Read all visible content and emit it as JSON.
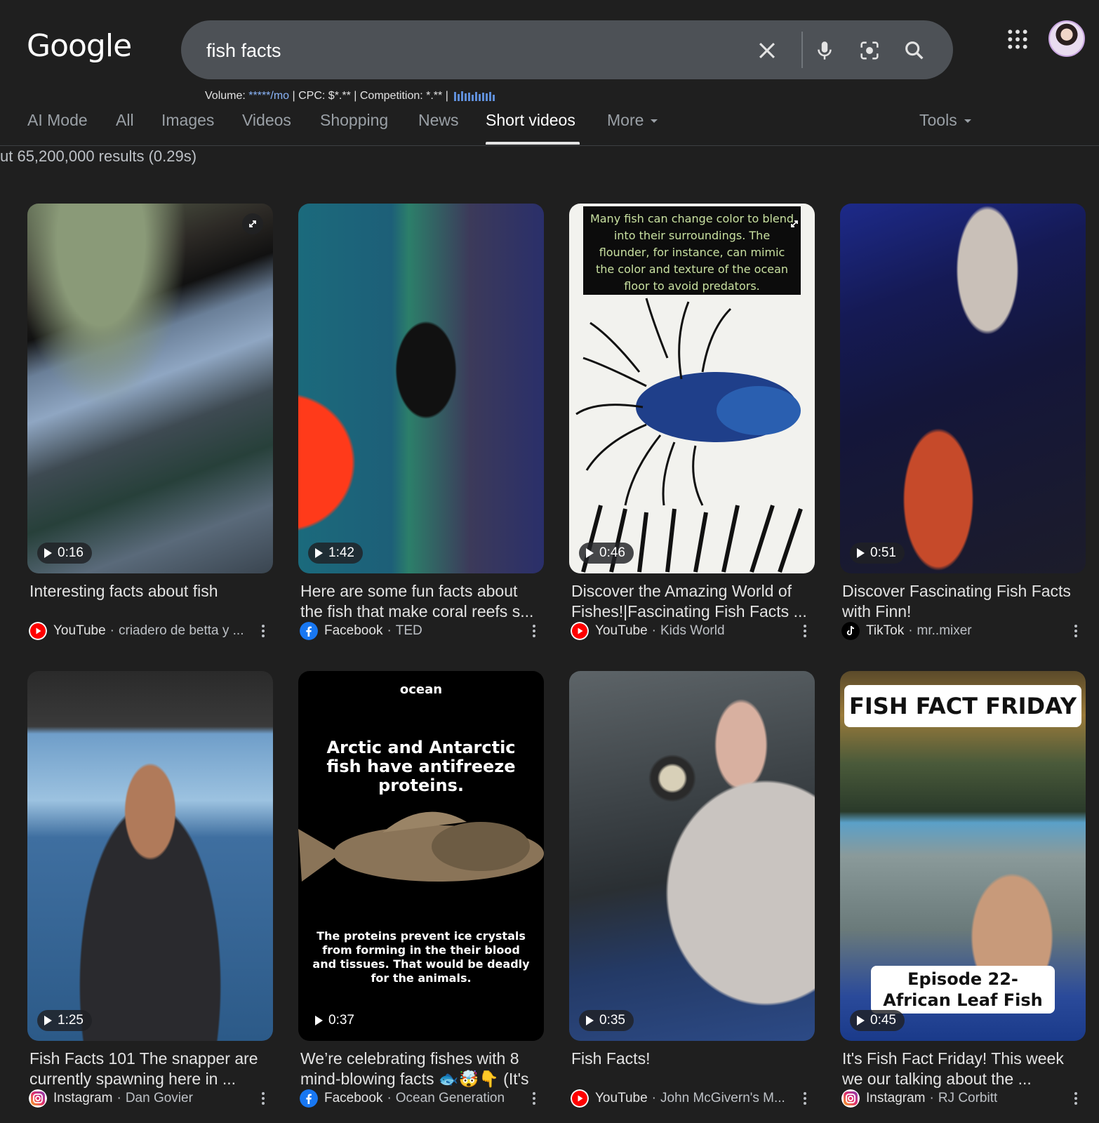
{
  "logo": "Google",
  "search": {
    "query": "fish facts",
    "clear_label": "✕"
  },
  "seo_bar": {
    "volume_label": "Volume: ",
    "volume_value": "*****/mo",
    "rest": " | CPC: $*.** | Competition: *.** | "
  },
  "tabs": [
    {
      "label": "AI Mode"
    },
    {
      "label": "All"
    },
    {
      "label": "Images"
    },
    {
      "label": "Videos"
    },
    {
      "label": "Shopping"
    },
    {
      "label": "News"
    },
    {
      "label": "Short videos",
      "active": true
    },
    {
      "label": "More"
    },
    {
      "label": "Tools"
    }
  ],
  "result_stats": "ut 65,200,000 results (0.29s)",
  "cards": [
    {
      "duration": "0:16",
      "title": "Interesting facts about fish",
      "platform": "YouTube",
      "channel": "criadero de betta y ..."
    },
    {
      "duration": "1:42",
      "title": "Here are some fun facts about the fish that make coral reefs s...",
      "platform": "Facebook",
      "channel": "TED"
    },
    {
      "duration": "0:46",
      "title": "Discover the Amazing World of Fishes!|Fascinating Fish Facts ...",
      "platform": "YouTube",
      "channel": "Kids World",
      "overlay": "Many fish can change color to blend into their surroundings. The flounder, for instance, can mimic the color and texture of the ocean floor to avoid predators."
    },
    {
      "duration": "0:51",
      "title": "Discover Fascinating Fish Facts with Finn!",
      "platform": "TikTok",
      "channel": "mr..mixer"
    },
    {
      "duration": "1:25",
      "title": "Fish Facts 101 The snapper are currently spawning here in ...",
      "platform": "Instagram",
      "channel": "Dan Govier"
    },
    {
      "duration": "0:37",
      "title": "We’re celebrating fishes with 8 mind-blowing facts 🐟🤯👇 (It's ...",
      "platform": "Facebook",
      "channel": "Ocean Generation",
      "overlay_brand": "ocean",
      "overlay_head": "Arctic and Antarctic fish have antifreeze proteins.",
      "overlay_body": "The proteins prevent ice crystals from forming in the their blood and tissues. That would be deadly for the animals."
    },
    {
      "duration": "0:35",
      "title": "Fish Facts!",
      "platform": "YouTube",
      "channel": "John McGivern's M..."
    },
    {
      "duration": "0:45",
      "title": "It's Fish Fact Friday! This week we our talking about the ...",
      "platform": "Instagram",
      "channel": "RJ Corbitt",
      "overlay_head": "FISH FACT FRIDAY",
      "overlay_foot": "Episode 22- African Leaf Fish"
    }
  ],
  "colors": {
    "background": "#1f1f1f",
    "search_box": "#4d5156",
    "link_blue": "#8ab4f8",
    "youtube_red": "#ff0000",
    "facebook_blue": "#1877f2"
  }
}
